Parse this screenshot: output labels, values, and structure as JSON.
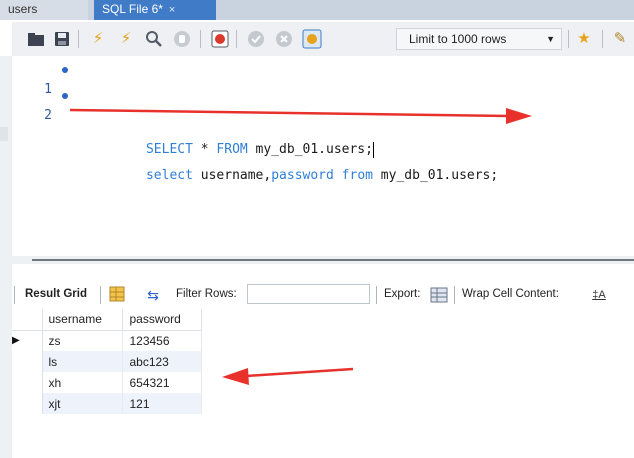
{
  "tabs": [
    {
      "label": "users",
      "close": ""
    },
    {
      "label": "SQL File 6*",
      "close": "×"
    }
  ],
  "toolbar": {
    "icons": [
      "open-folder-icon",
      "save-icon",
      "execute-icon",
      "execute-current-icon",
      "explain-icon",
      "stop-icon",
      "toggle-error-icon",
      "commit-icon",
      "rollback-icon",
      "autocommit-icon",
      "beautify-icon",
      "find-replace-icon"
    ],
    "limit_label": "Limit to 1000 rows"
  },
  "editor": {
    "lines": [
      {
        "num": "1",
        "tokens": [
          {
            "t": "SELECT",
            "k": "kw"
          },
          {
            "t": " * ",
            "k": "tx"
          },
          {
            "t": "FROM",
            "k": "kw"
          },
          {
            "t": " my_db_01.users;",
            "k": "tx"
          }
        ]
      },
      {
        "num": "2",
        "tokens": [
          {
            "t": "select",
            "k": "kw"
          },
          {
            "t": " username,",
            "k": "tx"
          },
          {
            "t": "password",
            "k": "kw"
          },
          {
            "t": " ",
            "k": "tx"
          },
          {
            "t": "from",
            "k": "kw"
          },
          {
            "t": " my_db_01.users;",
            "k": "tx"
          }
        ]
      }
    ]
  },
  "result_toolbar": {
    "result_grid": "Result Grid",
    "filter_rows": "Filter Rows:",
    "export": "Export:",
    "wrap_cell": "Wrap Cell Content:"
  },
  "grid": {
    "columns": [
      "username",
      "password"
    ],
    "rows": [
      [
        "zs",
        "123456"
      ],
      [
        "ls",
        "abc123"
      ],
      [
        "xh",
        "654321"
      ],
      [
        "xjt",
        "121"
      ]
    ]
  },
  "colors": {
    "tab_active": "#3f7bc7",
    "keyword": "#2f7fd6",
    "annotation_arrow": "#e8312b"
  }
}
